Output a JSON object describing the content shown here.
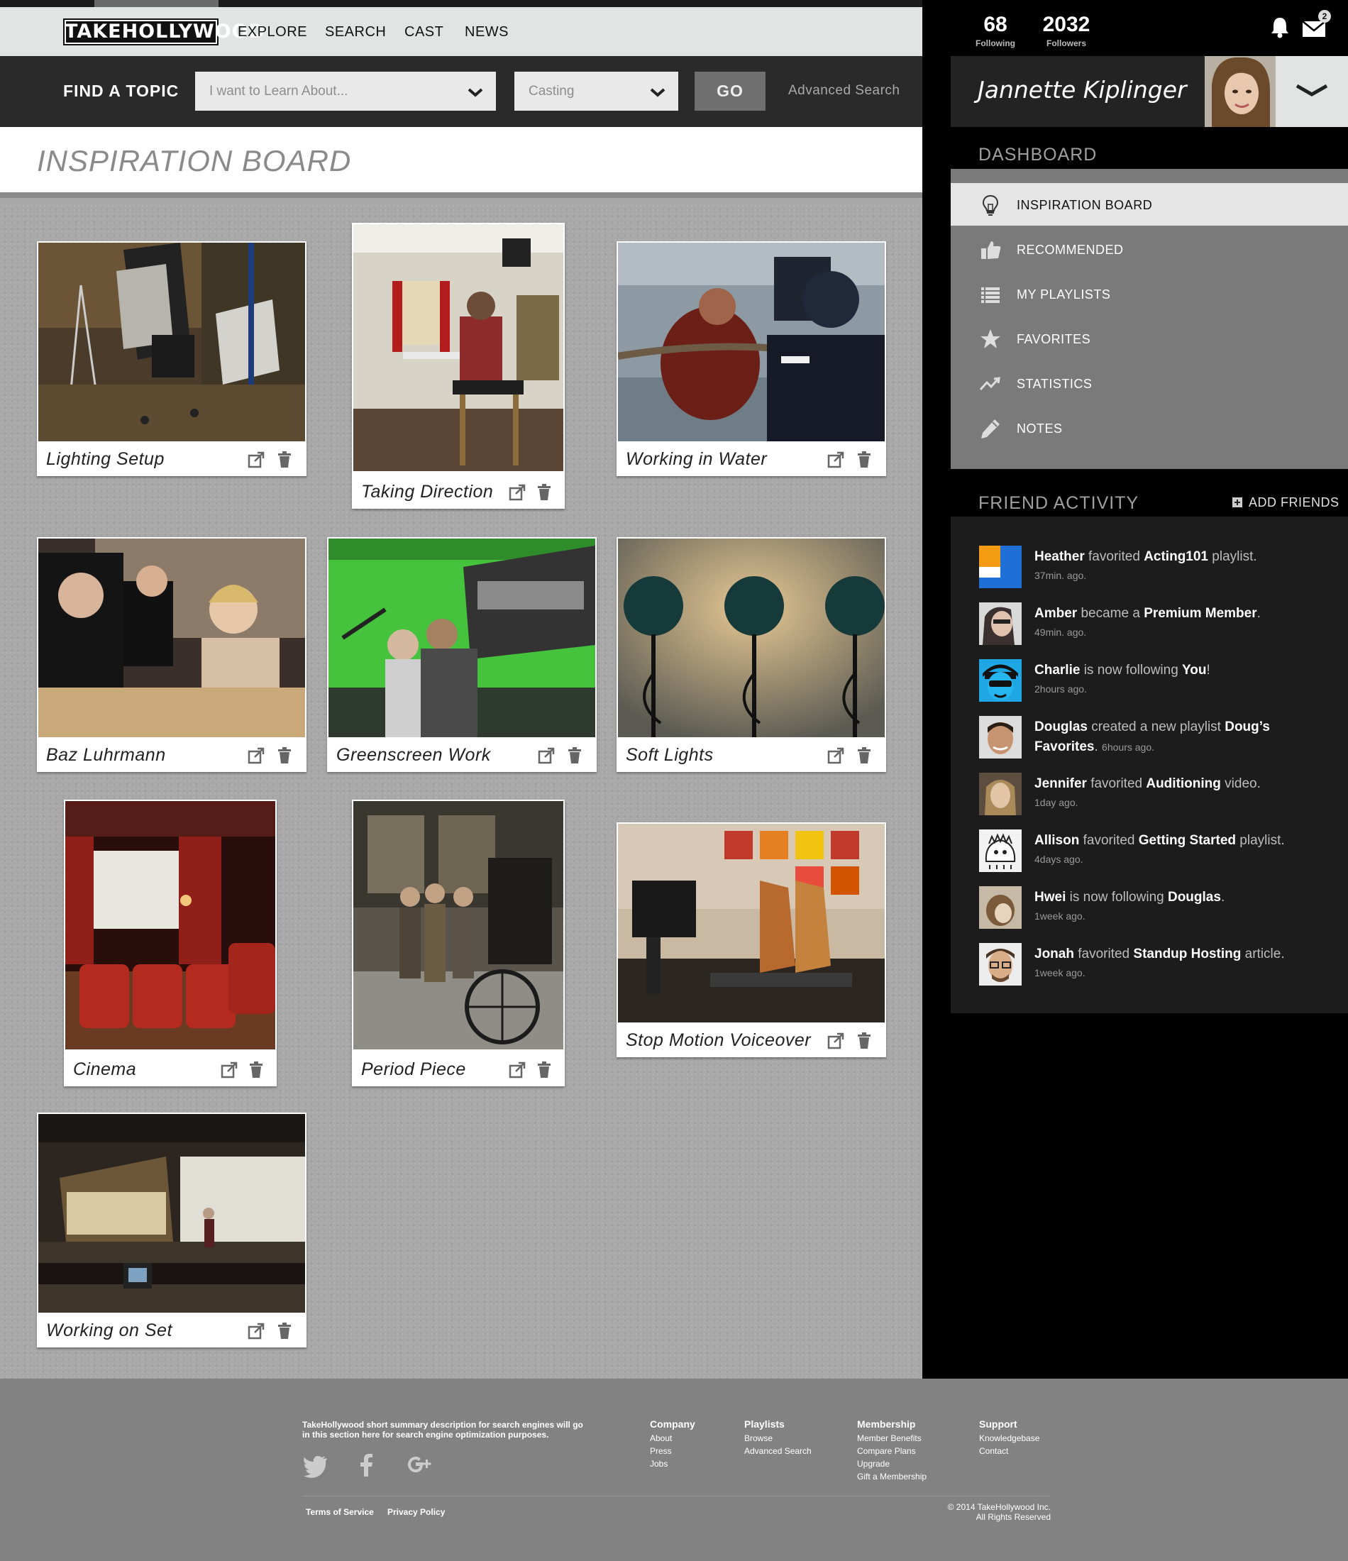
{
  "nav": {
    "logo": "TAKEHOLLYWOOD",
    "links": [
      "EXPLORE",
      "SEARCH",
      "CAST",
      "NEWS"
    ]
  },
  "search": {
    "find_label": "FIND A TOPIC",
    "topic_placeholder": "I want to Learn About...",
    "category_value": "Casting",
    "go_label": "GO",
    "advanced_label": "Advanced Search"
  },
  "board": {
    "title": "INSPIRATION BOARD",
    "cards": [
      {
        "title": "Lighting Setup"
      },
      {
        "title": "Taking Direction"
      },
      {
        "title": "Working in Water"
      },
      {
        "title": "Baz Luhrmann"
      },
      {
        "title": "Greenscreen Work"
      },
      {
        "title": "Soft Lights"
      },
      {
        "title": "Cinema"
      },
      {
        "title": "Period Piece"
      },
      {
        "title": "Stop Motion Voiceover"
      },
      {
        "title": "Working on Set"
      }
    ]
  },
  "profile": {
    "following_count": "68",
    "following_label": "Following",
    "followers_count": "2032",
    "followers_label": "Followers",
    "mail_badge": "2",
    "user_name": "Jannette Kiplinger"
  },
  "dashboard": {
    "title": "DASHBOARD",
    "items": [
      {
        "label": "INSPIRATION BOARD",
        "icon": "lightbulb-icon"
      },
      {
        "label": "RECOMMENDED",
        "icon": "thumbs-up-icon"
      },
      {
        "label": "MY PLAYLISTS",
        "icon": "list-icon"
      },
      {
        "label": "FAVORITES",
        "icon": "star-icon"
      },
      {
        "label": "STATISTICS",
        "icon": "trend-icon"
      },
      {
        "label": "NOTES",
        "icon": "pencil-icon"
      }
    ]
  },
  "friend_activity": {
    "title": "FRIEND ACTIVITY",
    "add_friends_label": "ADD FRIENDS",
    "items": [
      {
        "name": "Heather",
        "action": " favorited ",
        "target": "Acting101",
        "suffix": " playlist.",
        "time": "37min. ago."
      },
      {
        "name": "Amber",
        "action": " became a ",
        "target": "Premium Member",
        "suffix": ".",
        "time": "49min. ago."
      },
      {
        "name": "Charlie",
        "action": " is now following ",
        "target": "You",
        "suffix": "!",
        "time": "2hours ago."
      },
      {
        "name": "Douglas",
        "action": " created a new playlist ",
        "target": "Doug’s Favorites",
        "suffix": ".",
        "time": "6hours ago."
      },
      {
        "name": "Jennifer",
        "action": " favorited ",
        "target": "Auditioning",
        "suffix": " video.",
        "time": "1day ago."
      },
      {
        "name": "Allison",
        "action": " favorited ",
        "target": "Getting Started",
        "suffix": " playlist.",
        "time": "4days ago."
      },
      {
        "name": "Hwei",
        "action": " is now following ",
        "target": "Douglas",
        "suffix": ".",
        "time": "1week ago."
      },
      {
        "name": "Jonah",
        "action": " favorited ",
        "target": "Standup Hosting",
        "suffix": " article.",
        "time": "1week ago."
      }
    ]
  },
  "footer": {
    "description": "TakeHollywood short summary description for  search engines will go in this section here for search engine optimization purposes.",
    "columns": [
      {
        "heading": "Company",
        "links": [
          "About",
          "Press",
          "Jobs"
        ]
      },
      {
        "heading": "Playlists",
        "links": [
          "Browse",
          "Advanced Search"
        ]
      },
      {
        "heading": "Membership",
        "links": [
          "Member Benefits",
          "Compare Plans",
          "Upgrade",
          "Gift a Membership"
        ]
      },
      {
        "heading": "Support",
        "links": [
          "Knowledgebase",
          "Contact"
        ]
      }
    ],
    "legal": [
      "Terms of Service",
      "Privacy Policy"
    ],
    "copyright_line1": "© 2014 TakeHollywood Inc.",
    "copyright_line2": "All Rights Reserved"
  }
}
